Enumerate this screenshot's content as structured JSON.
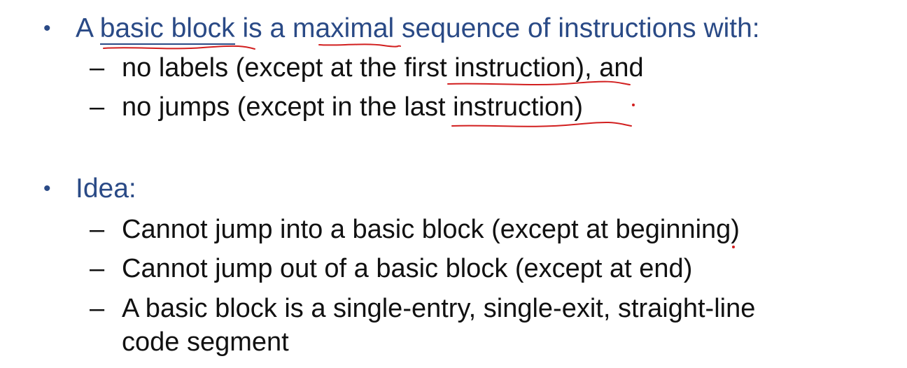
{
  "colors": {
    "heading_blue": "#2a4a86",
    "body_text": "#111111",
    "annotation_red": "#d21f1f"
  },
  "bullets": [
    {
      "text_prefix": "A ",
      "text_link": "basic block",
      "text_suffix": " is a maximal sequence of instructions with:",
      "subs": [
        "no labels (except at the first instruction), and",
        "no jumps (except in the last instruction)"
      ]
    },
    {
      "text": "Idea:",
      "subs": [
        "Cannot jump into a basic block (except at beginning)",
        "Cannot jump out of a basic block (except at end)",
        "A basic block is a single-entry, single-exit, straight-line",
        "code segment"
      ]
    }
  ],
  "glyphs": {
    "bullet": "•",
    "dash": "–"
  }
}
